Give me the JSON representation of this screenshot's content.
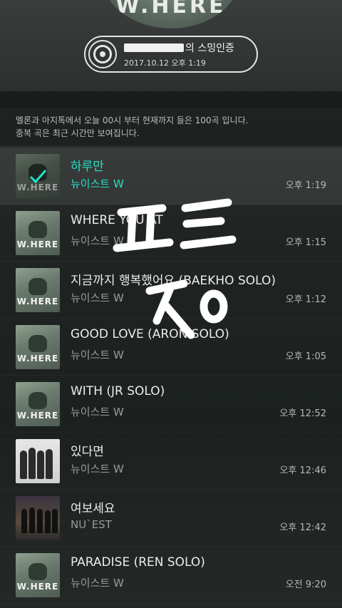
{
  "header": {
    "album_art_text": "W.HERE",
    "cert_title_suffix": "의 스밍인증",
    "cert_datetime": "2017.10.12 오후 1:19"
  },
  "notice": {
    "line1": "멜론과 아지톡에서 오늘 00시 부터 현재까지 들은 100곡 입니다.",
    "line2": "중복 곡은 최근 시간만 보여집니다."
  },
  "tracks": [
    {
      "title": "하루만",
      "artist": "뉴이스트 W",
      "time": "오후 1:19"
    },
    {
      "title": "WHERE YOU AT",
      "artist": "뉴이스트 W",
      "time": "오후 1:15"
    },
    {
      "title": "지금까지 행복했어요 (BAEKHO SOLO)",
      "artist": "뉴이스트 W",
      "time": "오후 1:12"
    },
    {
      "title": "GOOD LOVE (ARON SOLO)",
      "artist": "뉴이스트 W",
      "time": "오후 1:05"
    },
    {
      "title": "WITH (JR SOLO)",
      "artist": "뉴이스트 W",
      "time": "오후 12:52"
    },
    {
      "title": "있다면",
      "artist": "뉴이스트 W",
      "time": "오후 12:46"
    },
    {
      "title": "여보세요",
      "artist": "NU`EST",
      "time": "오후 12:42"
    },
    {
      "title": "PARADISE (REN SOLO)",
      "artist": "뉴이스트 W",
      "time": "오전 9:20"
    }
  ],
  "colors": {
    "accent": "#23e2c9",
    "background": "#1f2423"
  },
  "icons": {
    "cert": "disc-icon",
    "played": "check-icon"
  }
}
